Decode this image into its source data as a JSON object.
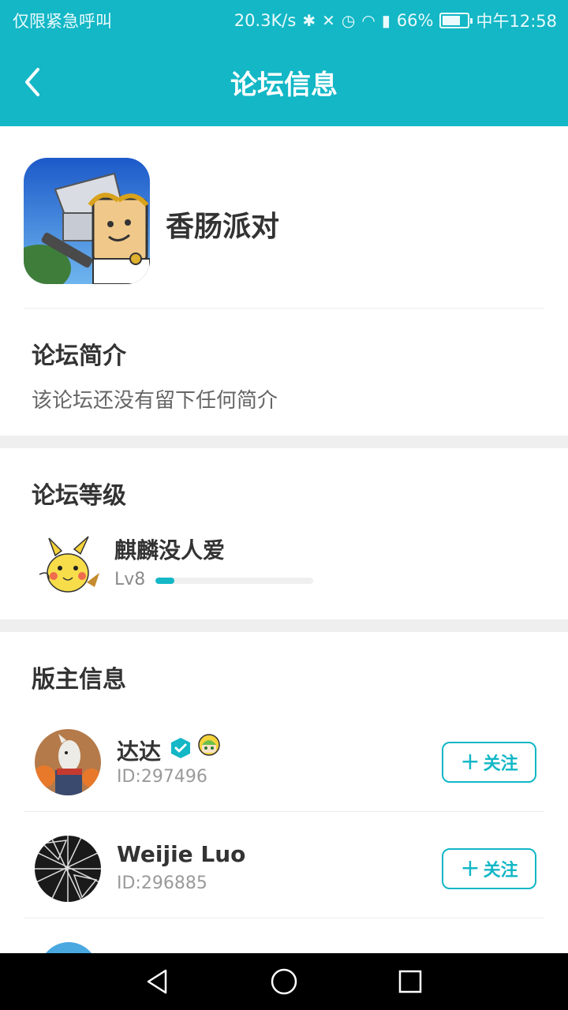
{
  "status_bar": {
    "left_text": "仅限紧急呼叫",
    "net_speed": "20.3K/s",
    "battery_percent": "66%",
    "time": "中午12:58",
    "icons": [
      "bluetooth-icon",
      "mute-icon",
      "alarm-icon",
      "wifi-icon",
      "signal-icon",
      "battery-icon"
    ]
  },
  "app_bar": {
    "title": "论坛信息",
    "back_icon": "chevron-left-icon"
  },
  "forum": {
    "name": "香肠派对"
  },
  "intro": {
    "title": "论坛简介",
    "text": "该论坛还没有留下任何简介"
  },
  "level": {
    "title": "论坛等级",
    "user": "麒麟没人爱",
    "level_label": "Lv8",
    "progress": 0.12
  },
  "moderators": {
    "title": "版主信息",
    "follow_label": "关注",
    "items": [
      {
        "name": "达达",
        "id": "ID:297496",
        "verified": true,
        "medal": true
      },
      {
        "name": "Weijie  Luo",
        "id": "ID:296885",
        "verified": false,
        "medal": false
      }
    ]
  },
  "colors": {
    "accent": "#13b7c6",
    "band": "#efefef",
    "nav": "#000000"
  },
  "nav_bar": {
    "icons": [
      "back-triangle-icon",
      "home-circle-icon",
      "recents-square-icon"
    ]
  }
}
